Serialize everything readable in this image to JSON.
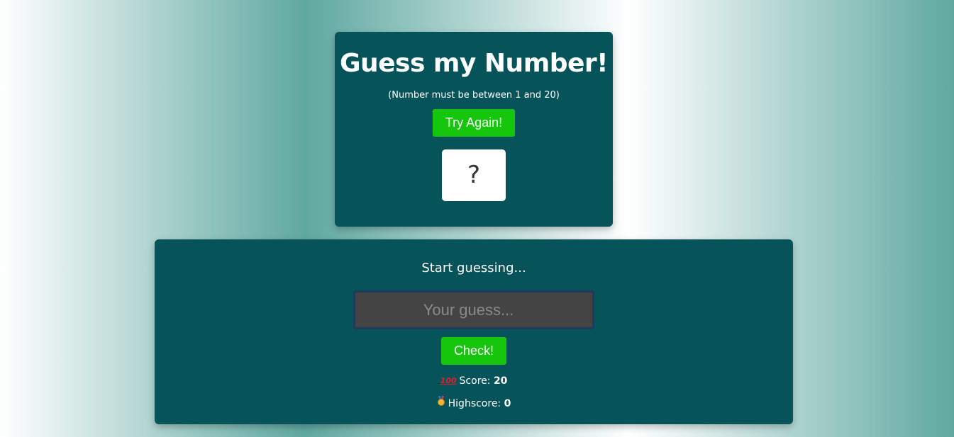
{
  "header": {
    "title": "Guess my Number!",
    "subtitle": "(Number must be between 1 and 20)",
    "again_label": "Try Again!",
    "secret_number": "?"
  },
  "main": {
    "message": "Start guessing...",
    "guess_placeholder": "Your guess...",
    "check_label": "Check!",
    "score_icon_text": "💯",
    "score_label": "Score: ",
    "score_value": "20",
    "highscore_label": "Highscore: ",
    "highscore_value": "0"
  },
  "icons": {
    "score": "hundred-points-icon",
    "highscore": "medal-icon"
  },
  "colors": {
    "card_background": "#06545a",
    "button": "#16c60c",
    "input_background": "#444444",
    "gradient_light": "#ffffff",
    "gradient_teal": "#5fa8a0"
  }
}
